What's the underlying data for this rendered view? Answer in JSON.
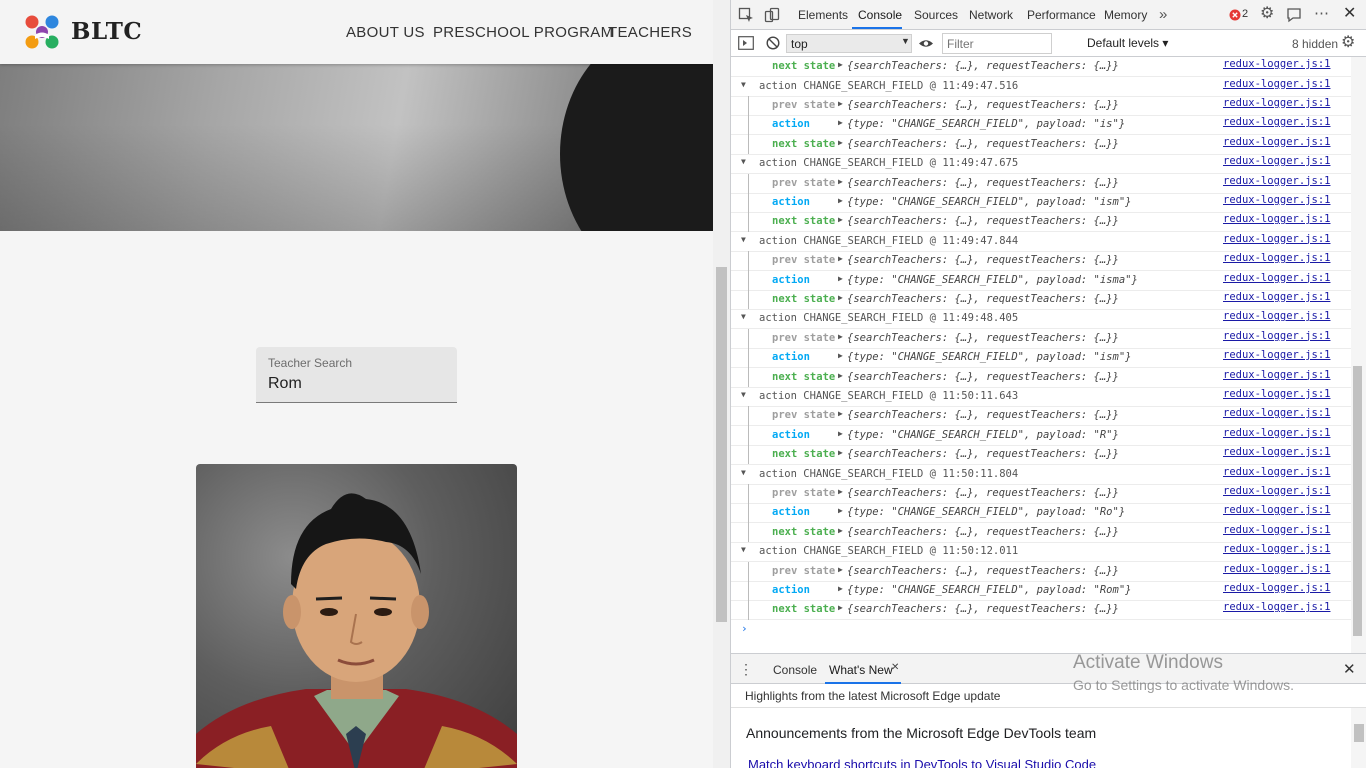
{
  "site": {
    "brand": "BLTC",
    "nav": [
      "ABOUT US",
      "PRESCHOOL PROGRAM",
      "TEACHERS"
    ],
    "search": {
      "label": "Teacher Search",
      "value": "Rom"
    }
  },
  "devtools": {
    "tabs": [
      "Elements",
      "Console",
      "Sources",
      "Network",
      "Performance",
      "Memory"
    ],
    "error_count": "2",
    "context": "top",
    "filter_placeholder": "Filter",
    "levels": "Default levels ▾",
    "hidden": "8 hidden",
    "source_link": "redux-logger.js:1",
    "labels": {
      "prev": "prev state",
      "action": "action",
      "next": "next state"
    },
    "state_text": "{searchTeachers: {…}, requestTeachers: {…}}",
    "first_next_state": "{searchTeachers: {…}, requestTeachers: {…}}",
    "groups": [
      {
        "title": "action CHANGE_SEARCH_FIELD @ 11:49:47.516",
        "payload": "{type: \"CHANGE_SEARCH_FIELD\", payload: \"is\"}"
      },
      {
        "title": "action CHANGE_SEARCH_FIELD @ 11:49:47.675",
        "payload": "{type: \"CHANGE_SEARCH_FIELD\", payload: \"ism\"}"
      },
      {
        "title": "action CHANGE_SEARCH_FIELD @ 11:49:47.844",
        "payload": "{type: \"CHANGE_SEARCH_FIELD\", payload: \"isma\"}"
      },
      {
        "title": "action CHANGE_SEARCH_FIELD @ 11:49:48.405",
        "payload": "{type: \"CHANGE_SEARCH_FIELD\", payload: \"ism\"}"
      },
      {
        "title": "action CHANGE_SEARCH_FIELD @ 11:50:11.643",
        "payload": "{type: \"CHANGE_SEARCH_FIELD\", payload: \"R\"}"
      },
      {
        "title": "action CHANGE_SEARCH_FIELD @ 11:50:11.804",
        "payload": "{type: \"CHANGE_SEARCH_FIELD\", payload: \"Ro\"}"
      },
      {
        "title": "action CHANGE_SEARCH_FIELD @ 11:50:12.011",
        "payload": "{type: \"CHANGE_SEARCH_FIELD\", payload: \"Rom\"}"
      }
    ],
    "drawer": {
      "tabs": [
        "Console",
        "What's New"
      ],
      "subtitle": "Highlights from the latest Microsoft Edge update",
      "announcement": "Announcements from the Microsoft Edge DevTools team",
      "link": "Match keyboard shortcuts in DevTools to Visual Studio Code"
    }
  },
  "watermark": {
    "title": "Activate Windows",
    "subtitle": "Go to Settings to activate Windows."
  },
  "colors": {
    "action_blue": "#03A9F4",
    "next_green": "#4CAF50",
    "prev_gray": "#9E9E9E",
    "tab_accent": "#1A73E8"
  },
  "icons": [
    "inspect-icon",
    "device-toggle-icon",
    "more-tabs-icon",
    "error-icon",
    "settings-gear-icon",
    "feedback-icon",
    "kebab-menu-icon",
    "close-icon",
    "sidebar-toggle-icon",
    "clear-console-icon",
    "eye-icon",
    "chevron-down-icon"
  ]
}
